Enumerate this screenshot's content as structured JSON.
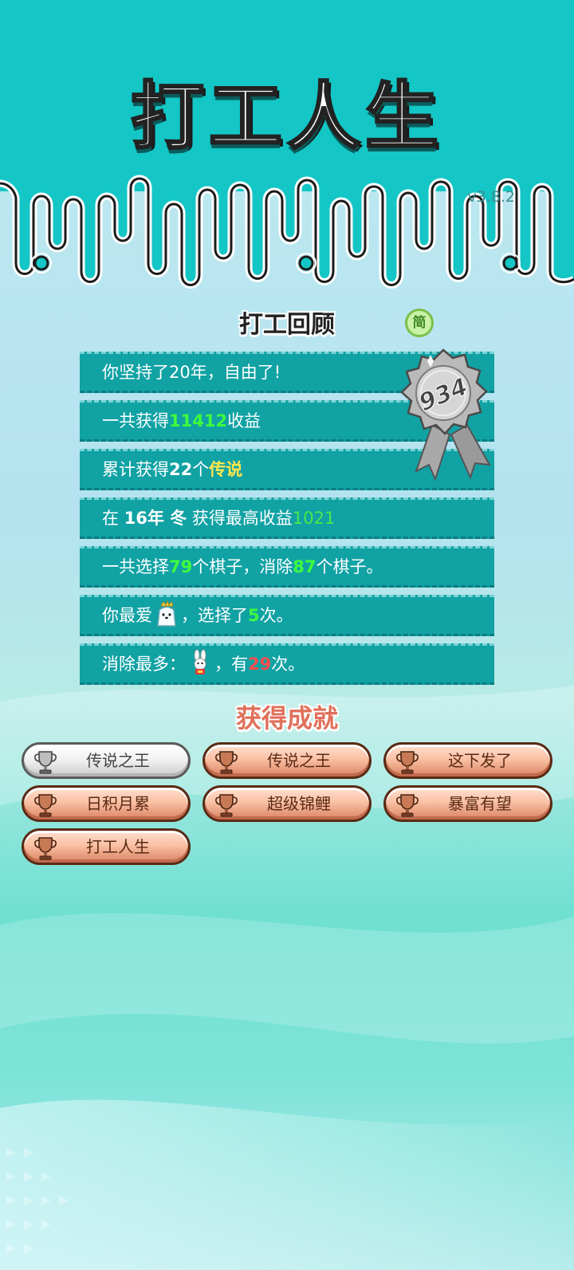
{
  "app": {
    "title": "打工人生",
    "version": "v3.8.2"
  },
  "review": {
    "title": "打工回顾",
    "lang_button": "简",
    "score": "934",
    "rows": [
      {
        "a": "你坚持了20年，自由了!"
      },
      {
        "a": "一共获得",
        "num": "11412",
        "b": "收益"
      },
      {
        "a": "累计获得",
        "num": "22",
        "mid": "个",
        "hl": "传说"
      },
      {
        "a": "在 ",
        "year": "16年 冬",
        "b": " 获得最高收益",
        "num": "1021"
      },
      {
        "a": "一共选择",
        "n1": "79",
        "b": "个棋子，消除",
        "n2": "87",
        "c": "个棋子。"
      },
      {
        "a": "你最爱",
        "b": "，选择了",
        "num": "5",
        "c": "次。"
      },
      {
        "a": "消除最多：",
        "b": "，有",
        "num": "29",
        "c": "次。"
      }
    ]
  },
  "achievements": {
    "title": "获得成就",
    "items": [
      {
        "label": "传说之王",
        "tier": "silver"
      },
      {
        "label": "传说之王",
        "tier": "bronze"
      },
      {
        "label": "这下发了",
        "tier": "bronze"
      },
      {
        "label": "日积月累",
        "tier": "bronze"
      },
      {
        "label": "超级锦鲤",
        "tier": "bronze"
      },
      {
        "label": "暴富有望",
        "tier": "bronze"
      },
      {
        "label": "打工人生",
        "tier": "bronze"
      }
    ]
  },
  "icons": {
    "favorite_piece": "polar-bear-king-icon",
    "most_eliminated": "rabbit-icon",
    "achievement": "trophy-icon",
    "score_badge": "rosette-medal-icon"
  },
  "colors": {
    "header_bg": "#14c4c4",
    "row_bg": "#11a2a4",
    "highlight_green": "#3dfc3d",
    "highlight_yellow": "#ffe74c",
    "highlight_red": "#ff4d4d",
    "achievement_title": "#e0705a"
  }
}
